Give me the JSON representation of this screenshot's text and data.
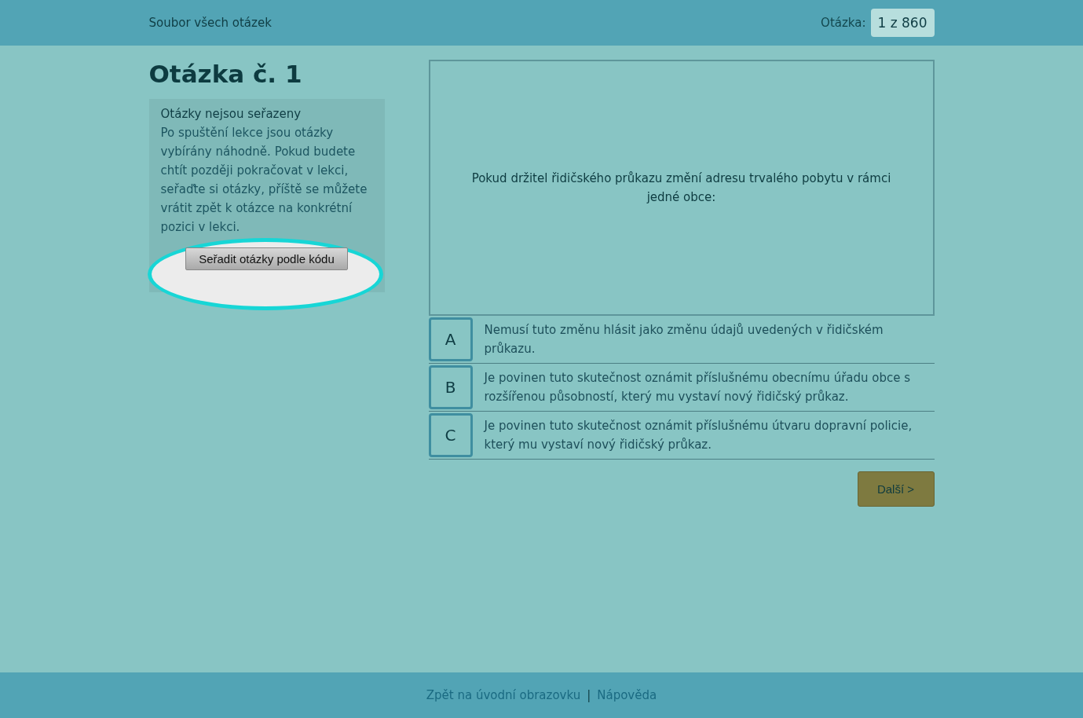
{
  "header": {
    "title": "Soubor všech otázek",
    "counter_label": "Otázka:",
    "counter_value": "1 z 860"
  },
  "question_heading": "Otázka č. 1",
  "info_panel": {
    "title": "Otázky nejsou seřazeny",
    "text": "Po spuštění lekce jsou otázky vybírány náhodně. Pokud budete chtít později pokračovat v lekci, seřaďte si otázky, příště se můžete vrátit zpět k otázce na konkrétní pozici v lekci.",
    "button": "Seřadit otázky podle kódu",
    "highlighted": true
  },
  "question_text": "Pokud držitel řidičského průkazu změní adresu trvalého pobytu v rámci jedné obce:",
  "answers": [
    {
      "letter": "A",
      "text": "Nemusí tuto změnu hlásit jako změnu údajů uvedených v řidičském průkazu."
    },
    {
      "letter": "B",
      "text": "Je povinen tuto skutečnost oznámit příslušnému obecnímu úřadu obce s rozšířenou působností, který mu vystaví nový řidičský průkaz."
    },
    {
      "letter": "C",
      "text": "Je povinen tuto skutečnost oznámit příslušnému útvaru dopravní policie, který mu vystaví nový řidičský průkaz."
    }
  ],
  "next_button": "Další >",
  "footer": {
    "links": [
      "Zpět na úvodní obrazovku",
      "Nápověda"
    ],
    "separator": "|"
  }
}
